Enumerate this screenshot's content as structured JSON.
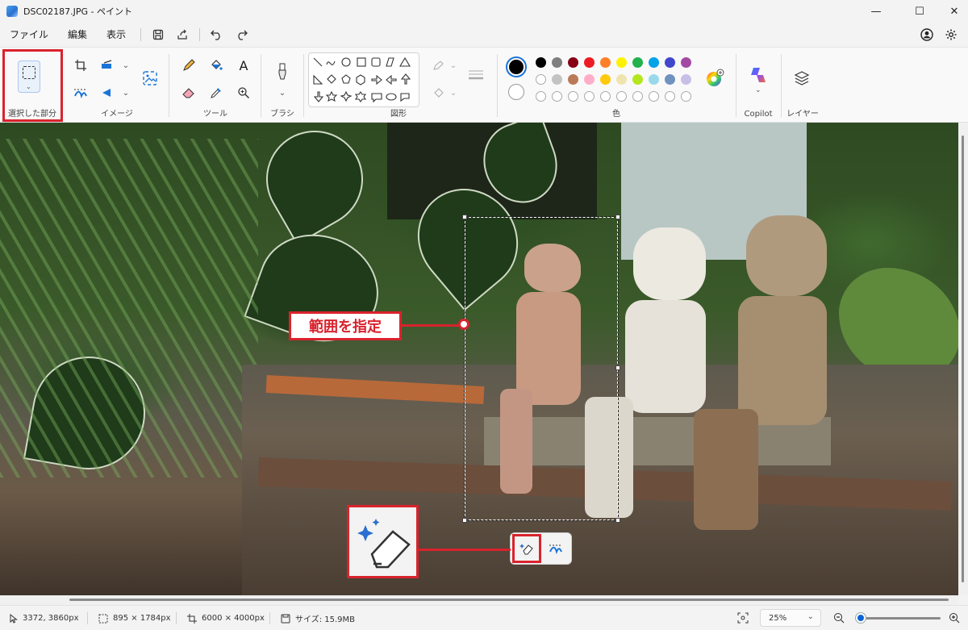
{
  "window": {
    "title": "DSC02187.JPG - ペイント",
    "controls": {
      "minimize": "—",
      "maximize": "☐",
      "close": "✕"
    }
  },
  "menu": {
    "items": [
      "ファイル",
      "編集",
      "表示"
    ]
  },
  "ribbon": {
    "groups": {
      "selection": "選択した部分",
      "image": "イメージ",
      "tools": "ツール",
      "brush": "ブラシ",
      "shapes": "図形",
      "colors": "色",
      "copilot": "Copilot",
      "layers": "レイヤー"
    },
    "palette_row1": [
      "#000000",
      "#7f7f7f",
      "#880015",
      "#ed1c24",
      "#ff7f27",
      "#fff200",
      "#22b14c",
      "#00a2e8",
      "#3f48cc",
      "#a349a4"
    ],
    "palette_row2": [
      "#ffffff",
      "#c3c3c3",
      "#b97a57",
      "#ffaec9",
      "#ffc90e",
      "#efe4b0",
      "#b5e61d",
      "#99d9ea",
      "#7092be",
      "#c8bfe7"
    ],
    "primary_color": "#000000",
    "secondary_color": "#ffffff"
  },
  "canvas": {
    "annotation_label": "範囲を指定",
    "annotation_color": "#d9232d"
  },
  "statusbar": {
    "cursor": "3372, 3860px",
    "selection": "895 × 1784px",
    "image_size": "6000 × 4000px",
    "file_size": "サイズ: 15.9MB",
    "zoom": "25%"
  }
}
